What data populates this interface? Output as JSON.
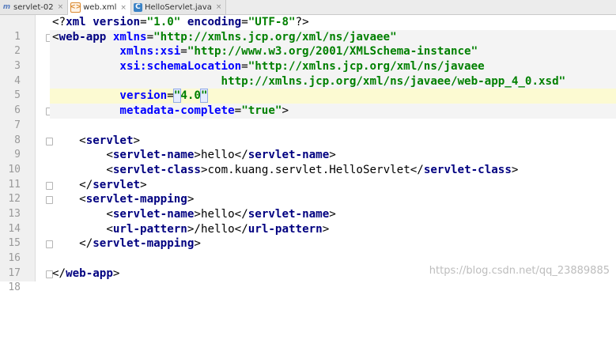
{
  "tabs": [
    {
      "label": "servlet-02",
      "icon": "module-icon",
      "active": false
    },
    {
      "label": "web.xml",
      "icon": "xml-file-icon",
      "active": true
    },
    {
      "label": "HelloServlet.java",
      "icon": "java-class-icon",
      "active": false
    }
  ],
  "close_glyph": "×",
  "line_numbers": [
    "1",
    "2",
    "3",
    "4",
    "5",
    "6",
    "7",
    "8",
    "9",
    "10",
    "11",
    "12",
    "13",
    "14",
    "15",
    "16",
    "17",
    "18"
  ],
  "code": {
    "l1": [
      "<?",
      "xml version",
      "=",
      "\"1.0\"",
      " encoding",
      "=",
      "\"UTF-8\"",
      "?>"
    ],
    "l2": [
      "<",
      "web-app",
      " xmlns",
      "=",
      "\"http://xmlns.jcp.org/xml/ns/javaee\""
    ],
    "l3": [
      "xmlns:xsi",
      "=",
      "\"http://www.w3.org/2001/XMLSchema-instance\""
    ],
    "l4": [
      "xsi:schemaLocation",
      "=",
      "\"http://xmlns.jcp.org/xml/ns/javaee"
    ],
    "l5": [
      "http://xmlns.jcp.org/xml/ns/javaee/web-app_4_0.xsd\""
    ],
    "l6": [
      "version",
      "=",
      "\"",
      "4.0",
      "\""
    ],
    "l7": [
      "metadata-complete",
      "=",
      "\"true\"",
      ">"
    ],
    "l9": [
      "<",
      "servlet",
      ">"
    ],
    "l10": [
      "<",
      "servlet-name",
      ">",
      "hello",
      "</",
      "servlet-name",
      ">"
    ],
    "l11": [
      "<",
      "servlet-class",
      ">",
      "com.kuang.servlet.HelloServlet",
      "</",
      "servlet-class",
      ">"
    ],
    "l12": [
      "</",
      "servlet",
      ">"
    ],
    "l13": [
      "<",
      "servlet-mapping",
      ">"
    ],
    "l14": [
      "<",
      "servlet-name",
      ">",
      "hello",
      "</",
      "servlet-name",
      ">"
    ],
    "l15": [
      "<",
      "url-pattern",
      ">",
      "/hello",
      "</",
      "url-pattern",
      ">"
    ],
    "l16": [
      "</",
      "servlet-mapping",
      ">"
    ],
    "l18": [
      "</",
      "web-app",
      ">"
    ]
  },
  "watermark": "https://blog.csdn.net/qq_23889885"
}
